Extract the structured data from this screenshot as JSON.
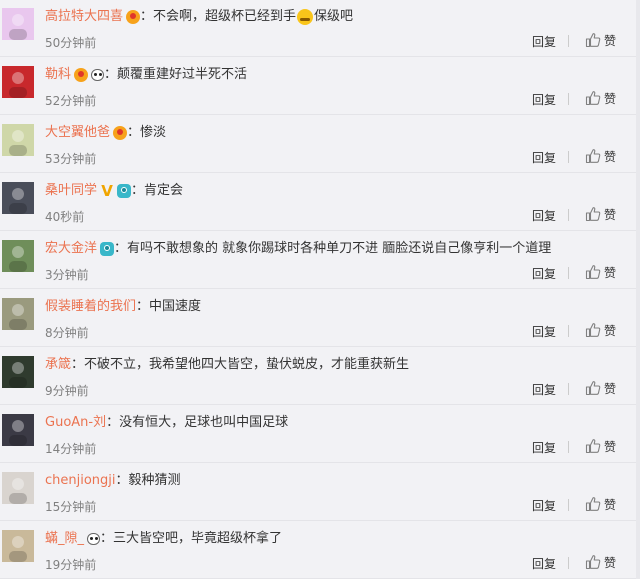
{
  "actions": {
    "reply": "回复",
    "like": "赞"
  },
  "comments": [
    {
      "user": "高拉特大四喜",
      "badges": [
        "fire-badge"
      ],
      "text_before": "不会啊，超级杯已经到手",
      "emoji": "laughing-tears-emoji",
      "text_after": "保级吧",
      "time": "50分钟前",
      "avatar_color": "#e9c7ee"
    },
    {
      "user": "勒科",
      "badges": [
        "fire-badge",
        "panda-badge"
      ],
      "text_before": "颠覆重建好过半死不活",
      "time": "52分钟前",
      "avatar_color": "#c8282c"
    },
    {
      "user": "大空翼他爸",
      "badges": [
        "fire-badge"
      ],
      "text_before": "惨淡",
      "time": "53分钟前",
      "avatar_color": "#cfd7a8"
    },
    {
      "user": "桑叶同学",
      "badges": [
        "vip-badge",
        "camera-badge"
      ],
      "text_before": "肯定会",
      "time": "40秒前",
      "avatar_color": "#4a4e5a"
    },
    {
      "user": "宏大金洋",
      "badges": [
        "camera-badge"
      ],
      "text_before": "有吗不敢想象的 就象你踢球时各种单刀不进 腼脸还说自己像亨利一个道理",
      "time": "3分钟前",
      "avatar_color": "#6f8e5a"
    },
    {
      "user": "假装睡着的我们",
      "badges": [],
      "text_before": "中国速度",
      "time": "8分钟前",
      "avatar_color": "#9a9a7e"
    },
    {
      "user": "承箴",
      "badges": [],
      "text_before": "不破不立，我希望他四大皆空，蛰伏蜕皮，才能重获新生",
      "time": "9分钟前",
      "avatar_color": "#2f3b2e"
    },
    {
      "user": "GuoAn-刘",
      "badges": [],
      "text_before": "没有恒大，足球也叫中国足球",
      "time": "14分钟前",
      "avatar_color": "#3b3a45"
    },
    {
      "user": "chenjiongji",
      "badges": [],
      "text_before": "毅种猜测",
      "time": "15分钟前",
      "avatar_color": "#d9d4cf"
    },
    {
      "user": "蟎_隙_",
      "badges": [
        "panda-badge"
      ],
      "text_before": "三大皆空吧，毕竟超级杯拿了",
      "time": "19分钟前",
      "avatar_color": "#c9b99a"
    }
  ]
}
